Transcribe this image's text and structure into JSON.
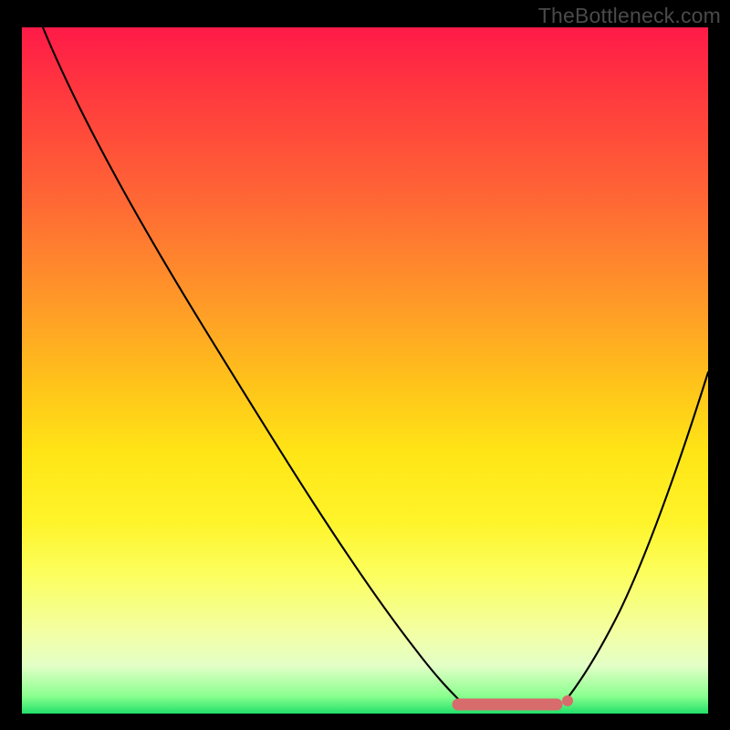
{
  "watermark": {
    "text": "TheBottleneck.com"
  },
  "chart_data": {
    "type": "line",
    "title": "",
    "xlabel": "",
    "ylabel": "",
    "xlim": [
      0,
      100
    ],
    "ylim": [
      0,
      100
    ],
    "grid": false,
    "legend": false,
    "background_gradient": {
      "direction": "top-to-bottom",
      "stops": [
        {
          "pos": 0,
          "color": "#ff1a48"
        },
        {
          "pos": 26,
          "color": "#ff6a34"
        },
        {
          "pos": 52,
          "color": "#ffc31a"
        },
        {
          "pos": 72,
          "color": "#fff42a"
        },
        {
          "pos": 93,
          "color": "#e3ffc7"
        },
        {
          "pos": 100,
          "color": "#22e06a"
        }
      ]
    },
    "series": [
      {
        "name": "bottleneck-curve-left",
        "x": [
          3,
          12,
          24,
          36,
          48,
          57,
          61,
          64
        ],
        "values": [
          100,
          86,
          66,
          46,
          27,
          11,
          4.5,
          1.2
        ]
      },
      {
        "name": "bottleneck-curve-right",
        "x": [
          79,
          84,
          88,
          92,
          96,
          100
        ],
        "values": [
          1.5,
          7,
          15,
          25,
          37,
          50
        ]
      },
      {
        "name": "optimal-range",
        "x": [
          63.5,
          79.5
        ],
        "values": [
          1.2,
          1.2
        ]
      }
    ],
    "accent_color": "#d86b6c"
  }
}
